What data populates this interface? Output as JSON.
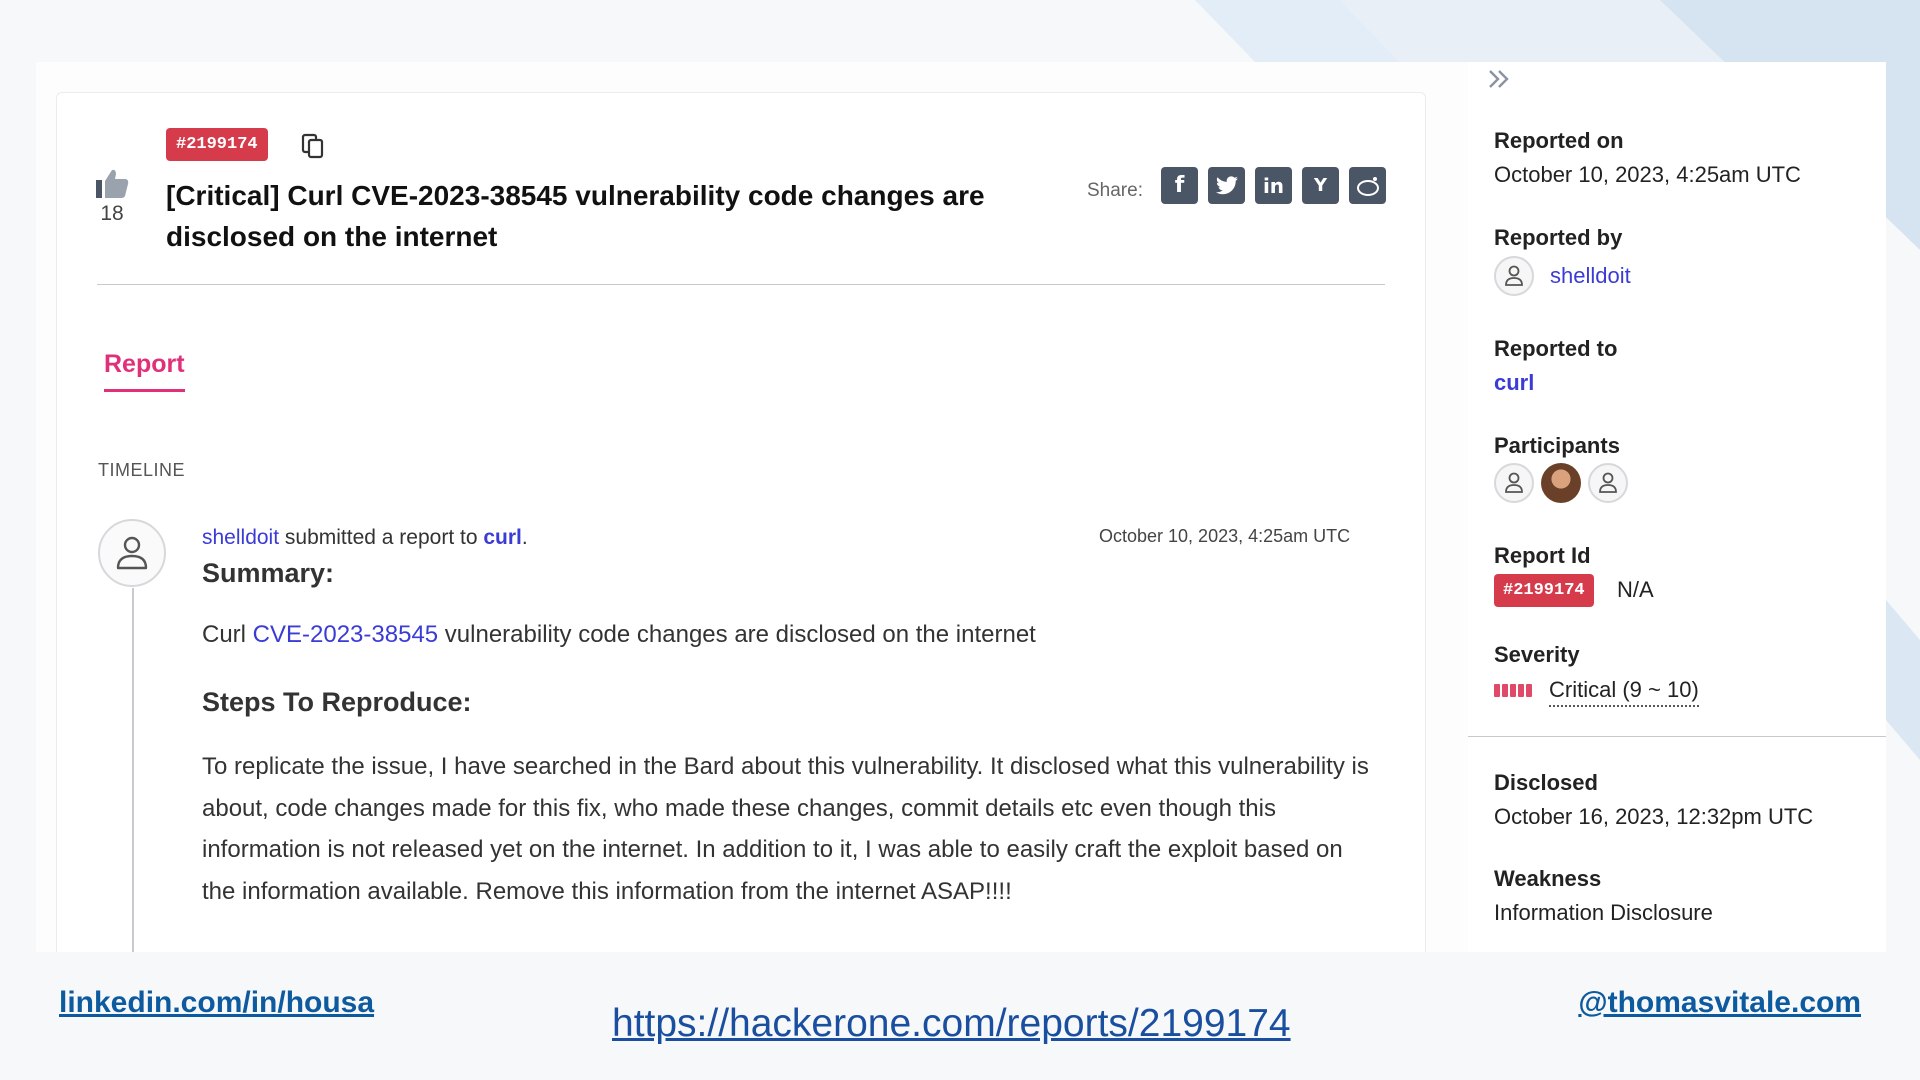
{
  "report": {
    "id_badge": "#2199174",
    "votes": "18",
    "title": "[Critical] Curl CVE-2023-38545 vulnerability code changes are disclosed on the internet",
    "share_label": "Share:",
    "share_icons": [
      "facebook-icon",
      "twitter-icon",
      "linkedin-icon",
      "ycombinator-icon",
      "reddit-icon"
    ],
    "share_glyphs": [
      "f",
      "t",
      "in",
      "Y",
      "r"
    ],
    "tab": "Report",
    "timeline_label": "TIMELINE"
  },
  "activity": {
    "user": "shelldoit",
    "action": " submitted a report to ",
    "target": "curl",
    "period": ".",
    "date": "October 10, 2023, 4:25am UTC"
  },
  "body": {
    "summary_heading": "Summary:",
    "summary_prefix": "Curl ",
    "summary_cve": "CVE-2023-38545",
    "summary_suffix": " vulnerability code changes are disclosed on the internet",
    "steps_heading": "Steps To Reproduce:",
    "steps_text": "To replicate the issue, I have searched in the Bard about this vulnerability. It disclosed what this vulnerability is about, code changes made for this fix, who made these changes, commit details etc even though this information is not released yet on the internet. In addition to it, I was able to easily craft the exploit based on the information available. Remove this information from the internet ASAP!!!!"
  },
  "sidebar": {
    "reported_on_label": "Reported on",
    "reported_on_value": "October 10, 2023, 4:25am UTC",
    "reported_by_label": "Reported by",
    "reported_by_value": "shelldoit",
    "reported_to_label": "Reported to",
    "reported_to_value": "curl",
    "participants_label": "Participants",
    "report_id_label": "Report Id",
    "report_id_badge": "#2199174",
    "report_id_extra": "N/A",
    "severity_label": "Severity",
    "severity_value": "Critical (9 ~ 10)",
    "severity_level": 5,
    "disclosed_label": "Disclosed",
    "disclosed_value": "October 16, 2023, 12:32pm UTC",
    "weakness_label": "Weakness",
    "weakness_value": "Information Disclosure"
  },
  "footer": {
    "left": "linkedin.com/in/housa",
    "center": "https://hackerone.com/reports/2199174",
    "right": "@thomasvitale.com"
  },
  "colors": {
    "accent_pink": "#e0307a",
    "badge_red": "#d63b4c",
    "link_blue": "#3b3bd6"
  }
}
